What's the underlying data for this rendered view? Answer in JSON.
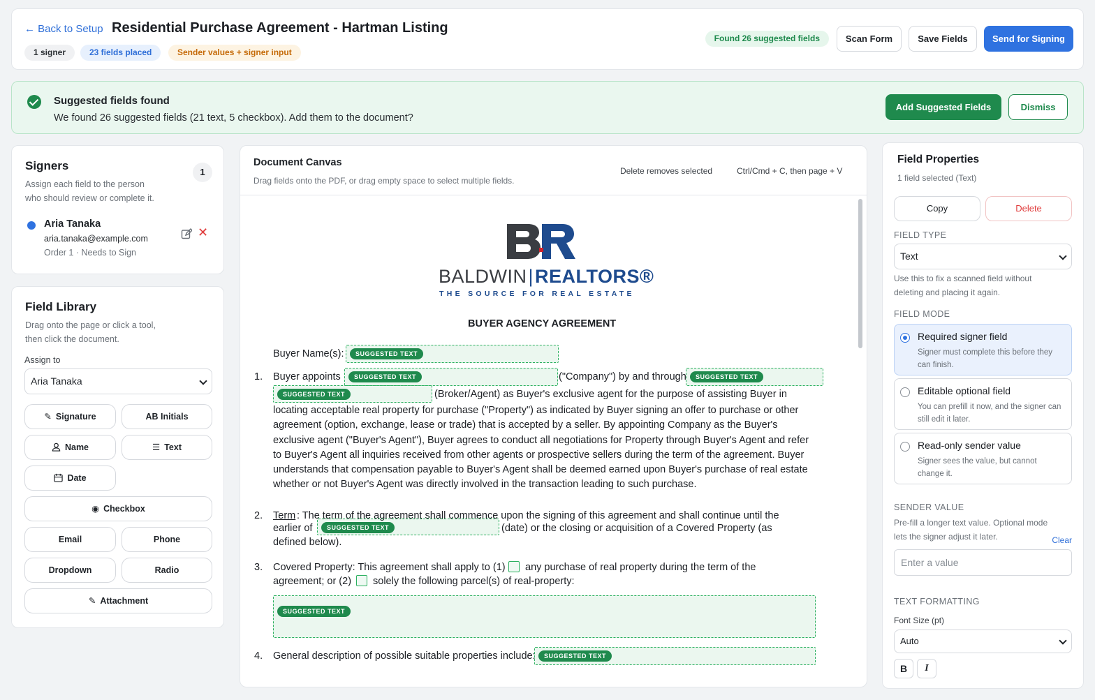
{
  "header": {
    "back_label": "← Back to Setup",
    "title": "Residential Purchase Agreement - Hartman Listing",
    "pills": {
      "signers": "1 signer",
      "fields_placed": "23 fields placed",
      "mode": "Sender values + signer input"
    },
    "found_badge": "Found 26 suggested fields",
    "scan_label": "Scan Form",
    "save_label": "Save Fields",
    "send_label": "Send for Signing"
  },
  "banner": {
    "title": "Suggested fields found",
    "text": "We found 26 suggested fields (21 text, 5 checkbox). Add them to the document?",
    "add_label": "Add Suggested Fields",
    "dismiss_label": "Dismiss"
  },
  "signers": {
    "title": "Signers",
    "subtitle_1": "Assign each field to the person",
    "subtitle_2": "who should review or complete it.",
    "count": "1",
    "items": [
      {
        "name": "Aria Tanaka",
        "email": "aria.tanaka@example.com",
        "order": "Order 1 · Needs to Sign"
      }
    ]
  },
  "library": {
    "title": "Field Library",
    "subtitle_1": "Drag onto the page or click a tool,",
    "subtitle_2": "then click the document.",
    "assign_label": "Assign to",
    "assign_value": "Aria Tanaka",
    "tools": {
      "signature": "Signature",
      "initials": "AB Initials",
      "name": "Name",
      "text": "Text",
      "date": "Date",
      "checkbox": "Checkbox",
      "email": "Email",
      "phone": "Phone",
      "dropdown": "Dropdown",
      "radio": "Radio",
      "attachment": "Attachment"
    }
  },
  "canvas": {
    "title": "Document Canvas",
    "subtitle": "Drag fields onto the PDF, or drag empty space to select multiple fields.",
    "hint_delete": "Delete removes selected",
    "hint_copy": "Ctrl/Cmd + C, then page + V",
    "suggested_chip": "SUGGESTED TEXT",
    "document": {
      "logo_baldwin": "BALDWIN",
      "logo_realtors": "REALTORS®",
      "logo_tagline": "THE SOURCE FOR REAL ESTATE",
      "heading": "BUYER AGENCY AGREEMENT",
      "buyer_names": "Buyer Name(s):",
      "n1": "1.",
      "s1_a": "Buyer appoints",
      "s1_b": "(\"Company\") by and through",
      "s1_c": "(Broker/Agent) as Buyer's exclusive agent for the purpose of assisting Buyer in",
      "s1_body": "locating acceptable real property for purchase (\"Property\") as indicated by Buyer signing an offer to purchase or other agreement (option, exchange, lease or trade) that is accepted by a seller.  By appointing Company as the Buyer's exclusive agent (\"Buyer's Agent\"), Buyer agrees to conduct all negotiations for Property through Buyer's Agent and refer to Buyer's Agent all inquiries received from other agents or prospective sellers during the term of the agreement.  Buyer understands that compensation payable to Buyer's Agent shall be deemed earned upon Buyer's purchase of real estate whether or not Buyer's Agent was directly involved in the transaction leading to such purchase.",
      "n2": "2.",
      "s2_term": "Term",
      "s2_a": ":  The term of the agreement shall commence upon the signing of this agreement and shall continue until the",
      "s2_b": "earlier of",
      "s2_c": "(date) or the closing or acquisition of a Covered Property (as",
      "s2_d": "defined below).",
      "n3": "3.",
      "s3_a": "Covered Property: This agreement shall apply to (1)",
      "s3_b": "any purchase of real property during the term of the",
      "s3_c": "agreement; or (2)",
      "s3_d": "solely the following parcel(s) of real-property:",
      "n4": "4.",
      "s4_a": "General description of possible suitable properties include:"
    }
  },
  "properties": {
    "title": "Field Properties",
    "subtitle": "1 field selected (Text)",
    "copy_label": "Copy",
    "delete_label": "Delete",
    "field_type_label": "FIELD TYPE",
    "field_type_value": "Text",
    "field_type_help": "Use this to fix a scanned field without deleting and placing it again.",
    "field_mode_label": "FIELD MODE",
    "modes": [
      {
        "title": "Required signer field",
        "desc": "Signer must complete this before they can finish.",
        "selected": true
      },
      {
        "title": "Editable optional field",
        "desc": "You can prefill it now, and the signer can still edit it later.",
        "selected": false
      },
      {
        "title": "Read-only sender value",
        "desc": "Signer sees the value, but cannot change it.",
        "selected": false
      }
    ],
    "sender_value_label": "SENDER VALUE",
    "sender_value_help": "Pre-fill a longer text value. Optional mode lets the signer adjust it later.",
    "clear_label": "Clear",
    "sender_value_placeholder": "Enter a value",
    "text_formatting_label": "TEXT FORMATTING",
    "font_size_label": "Font Size (pt)",
    "font_size_value": "Auto",
    "bold_label": "B",
    "italic_label": "I"
  },
  "colors": {
    "accent_blue": "#2f72e0",
    "success_green": "#1f8a4d",
    "danger_red": "#e03c3c",
    "brand_navy": "#1e4b8e"
  }
}
